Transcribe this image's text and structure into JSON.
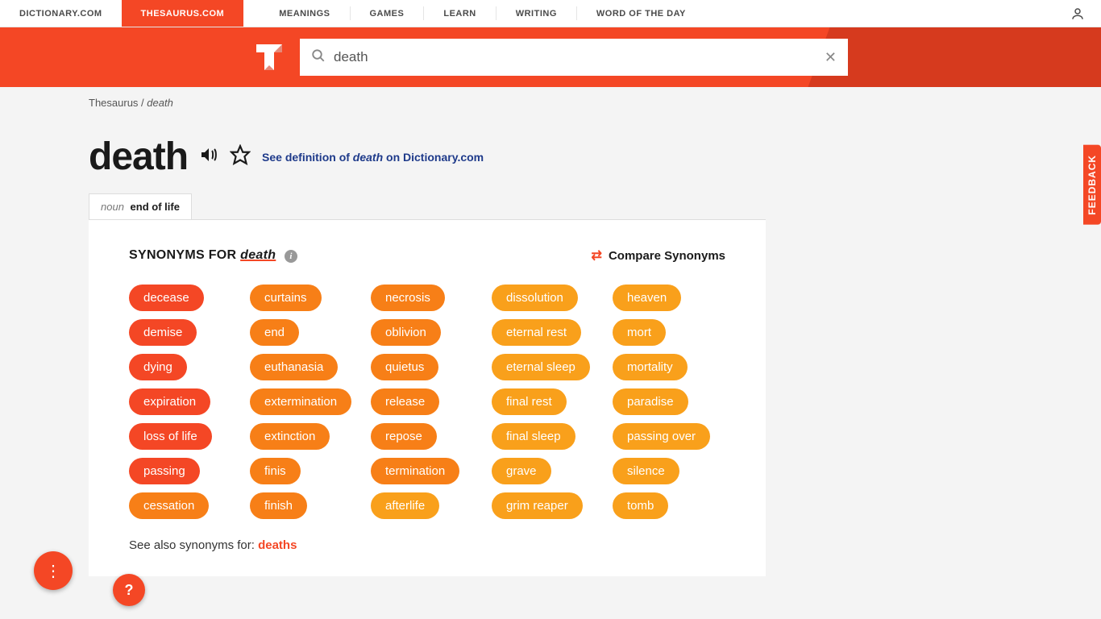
{
  "topnav": {
    "dictionary": "DICTIONARY.COM",
    "thesaurus": "THESAURUS.COM",
    "links": [
      "MEANINGS",
      "GAMES",
      "LEARN",
      "WRITING",
      "WORD OF THE DAY"
    ]
  },
  "search": {
    "value": "death"
  },
  "breadcrumb": {
    "root": "Thesaurus",
    "sep": " / ",
    "current": "death"
  },
  "head": {
    "word": "death",
    "deflink_prefix": "See definition of ",
    "deflink_word": "death",
    "deflink_suffix": " on Dictionary.com"
  },
  "postab": {
    "pos": "noun",
    "sense": "end of life"
  },
  "card": {
    "synfor_label": "SYNONYMS FOR ",
    "synfor_word": "death",
    "compare": "Compare Synonyms",
    "columns": [
      [
        {
          "w": "decease",
          "r": 1
        },
        {
          "w": "demise",
          "r": 1
        },
        {
          "w": "dying",
          "r": 1
        },
        {
          "w": "expiration",
          "r": 1
        },
        {
          "w": "loss of life",
          "r": 1
        },
        {
          "w": "passing",
          "r": 1
        },
        {
          "w": "cessation",
          "r": 2
        }
      ],
      [
        {
          "w": "curtains",
          "r": 2
        },
        {
          "w": "end",
          "r": 2
        },
        {
          "w": "euthanasia",
          "r": 2
        },
        {
          "w": "extermination",
          "r": 2
        },
        {
          "w": "extinction",
          "r": 2
        },
        {
          "w": "finis",
          "r": 2
        },
        {
          "w": "finish",
          "r": 2
        }
      ],
      [
        {
          "w": "necrosis",
          "r": 2
        },
        {
          "w": "oblivion",
          "r": 2
        },
        {
          "w": "quietus",
          "r": 2
        },
        {
          "w": "release",
          "r": 2
        },
        {
          "w": "repose",
          "r": 2
        },
        {
          "w": "termination",
          "r": 2
        },
        {
          "w": "afterlife",
          "r": 3
        }
      ],
      [
        {
          "w": "dissolution",
          "r": 3
        },
        {
          "w": "eternal rest",
          "r": 3
        },
        {
          "w": "eternal sleep",
          "r": 3
        },
        {
          "w": "final rest",
          "r": 3
        },
        {
          "w": "final sleep",
          "r": 3
        },
        {
          "w": "grave",
          "r": 3
        },
        {
          "w": "grim reaper",
          "r": 3
        }
      ],
      [
        {
          "w": "heaven",
          "r": 3
        },
        {
          "w": "mort",
          "r": 3
        },
        {
          "w": "mortality",
          "r": 3
        },
        {
          "w": "paradise",
          "r": 3
        },
        {
          "w": "passing over",
          "r": 3
        },
        {
          "w": "silence",
          "r": 3
        },
        {
          "w": "tomb",
          "r": 3
        }
      ]
    ],
    "seealso_label": "See also synonyms for: ",
    "seealso_link": "deaths"
  },
  "feedback": "FEEDBACK"
}
